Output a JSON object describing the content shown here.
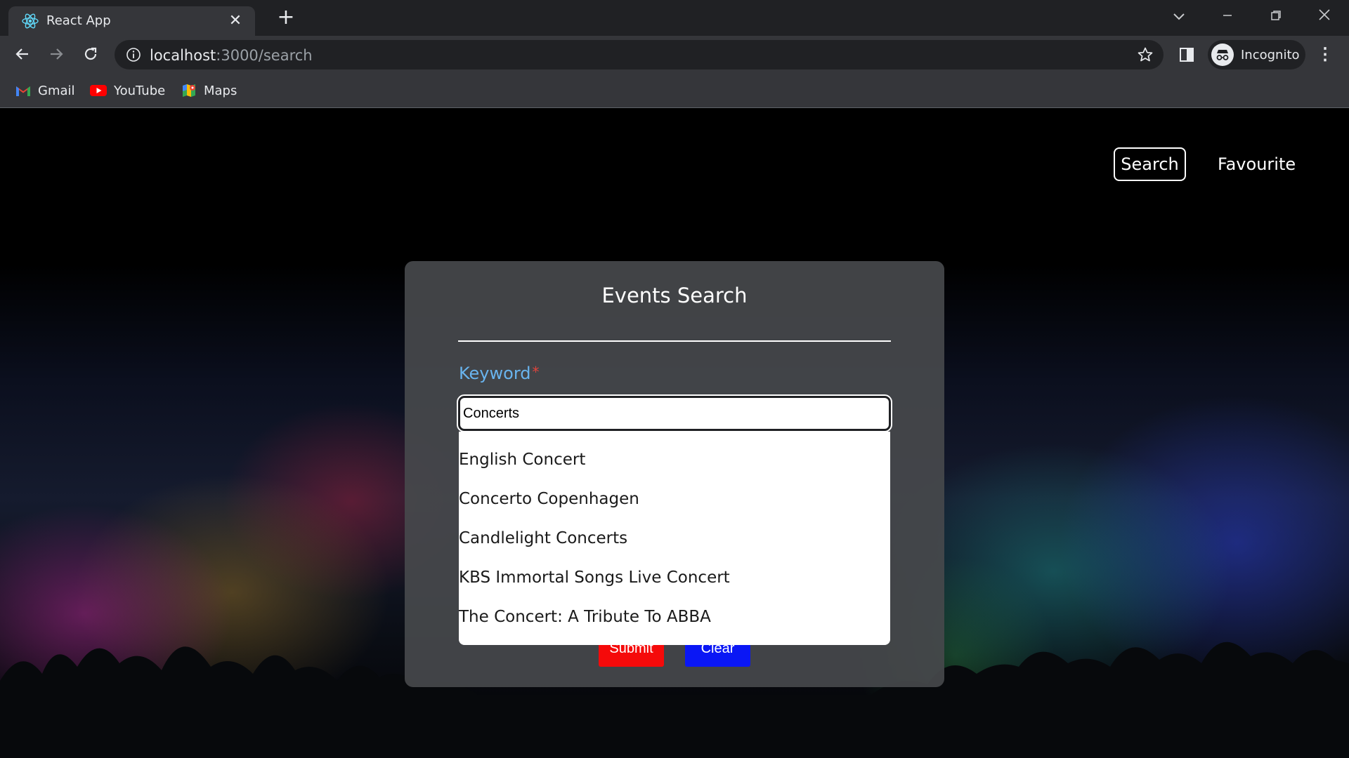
{
  "browser": {
    "tab_title": "React App",
    "tab_favicon": "react-logo-icon",
    "close_glyph": "✕",
    "new_tab_glyph": "+",
    "url_host": "localhost",
    "url_rest": ":3000/search",
    "profile_label": "Incognito",
    "bookmarks": [
      {
        "label": "Gmail",
        "icon": "gmail-icon"
      },
      {
        "label": "YouTube",
        "icon": "youtube-icon"
      },
      {
        "label": "Maps",
        "icon": "maps-icon"
      }
    ]
  },
  "nav": {
    "search_label": "Search",
    "favourite_label": "Favourite"
  },
  "form": {
    "title": "Events Search",
    "keyword_label": "Keyword",
    "required_mark": "*",
    "keyword_value": "Concerts",
    "submit_label": "Submit",
    "clear_label": "Clear"
  },
  "suggestions": [
    "English Concert",
    "Concerto Copenhagen",
    "Candlelight Concerts",
    "KBS Immortal Songs Live Concert",
    "The Concert: A Tribute To ABBA"
  ],
  "colors": {
    "keyword_label": "#69b4ee",
    "submit_button": "#f50a0a",
    "clear_button": "#0a17f5",
    "card_background": "#46484b"
  }
}
